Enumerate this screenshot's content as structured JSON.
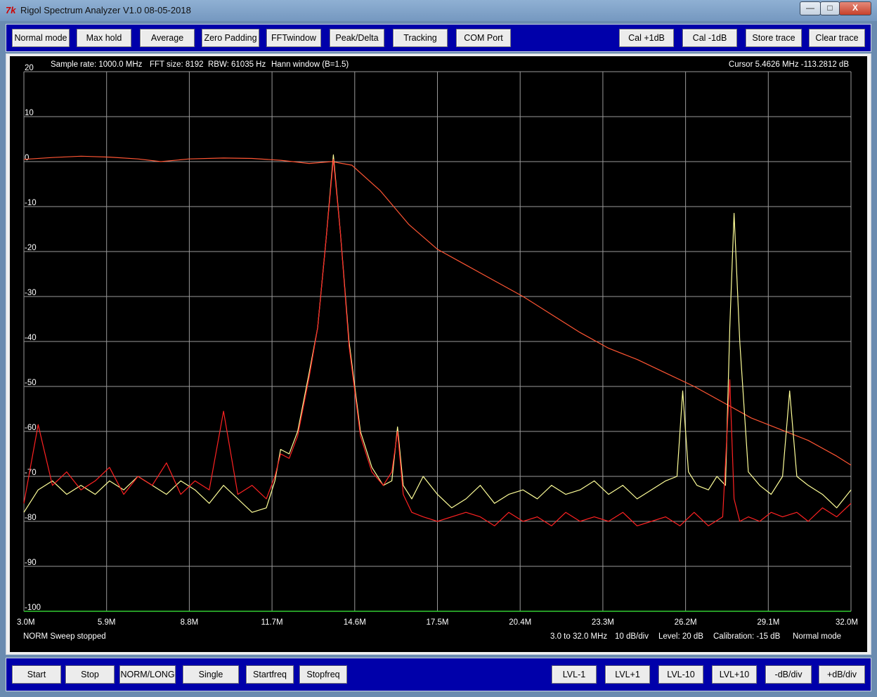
{
  "window": {
    "title": "Rigol Spectrum Analyzer V1.0 08-05-2018",
    "icon": "tk-feather-icon",
    "controls": [
      "—",
      "□",
      "X"
    ]
  },
  "toolbar_top": {
    "left": [
      "Normal mode",
      "Max hold",
      "Average",
      "Zero Padding",
      "FFTwindow",
      "Peak/Delta",
      "Tracking",
      "COM Port"
    ],
    "right": [
      "Cal +1dB",
      "Cal -1dB",
      "Store trace",
      "Clear trace"
    ]
  },
  "info": {
    "sample_rate": "Sample rate: 1000.0 MHz",
    "fft_size": "FFT size: 8192",
    "rbw": "RBW: 61035 Hz",
    "window": "Hann window (B=1.5)",
    "cursor": "Cursor 5.4626 MHz   -113.2812 dB"
  },
  "status": {
    "left": "NORM Sweep stopped",
    "span": "3.0 to 32.0 MHz",
    "scale": "10 dB/div",
    "level": "Level: 20 dB",
    "calibration": "Calibration: -15 dB",
    "mode": "Normal mode"
  },
  "toolbar_bottom": {
    "left": [
      "Start",
      "Stop",
      "NORM/LONG",
      "Single",
      "Startfreq",
      "Stopfreq"
    ],
    "right": [
      "LVL-1",
      "LVL+1",
      "LVL-10",
      "LVL+10",
      "-dB/div",
      "+dB/div"
    ]
  },
  "chart_data": {
    "type": "line",
    "xlabel": "",
    "ylabel": "",
    "xlim": [
      3.0,
      32.0
    ],
    "ylim": [
      -100,
      20
    ],
    "x_ticks": [
      "3.0M",
      "5.9M",
      "8.8M",
      "11.7M",
      "14.6M",
      "17.5M",
      "20.4M",
      "23.3M",
      "26.2M",
      "29.1M",
      "32.0M"
    ],
    "y_ticks": [
      "20",
      "10",
      "0",
      "-10",
      "-20",
      "-30",
      "-40",
      "-50",
      "-60",
      "-70",
      "-80",
      "-90",
      "-100"
    ],
    "grid": true,
    "colors": {
      "background": "#000000",
      "grid": "#9a9a9a",
      "baseline": "#33cc33",
      "filter": "#ff5533",
      "live": "#ffff99",
      "stored": "#ff2222"
    },
    "series": [
      {
        "color": "#ff5533",
        "x": [
          3.0,
          4.0,
          5.0,
          6.0,
          7.0,
          7.8,
          8.8,
          10.0,
          11.0,
          12.0,
          13.0,
          13.8,
          14.5,
          15.5,
          16.5,
          17.5,
          18.5,
          19.5,
          20.5,
          21.5,
          22.5,
          23.5,
          24.5,
          25.5,
          26.5,
          27.5,
          28.5,
          29.5,
          30.5,
          31.5,
          32.0
        ],
        "y": [
          0.5,
          0.9,
          1.2,
          1.0,
          0.6,
          0.0,
          0.6,
          0.8,
          0.7,
          0.3,
          -0.4,
          0.0,
          -0.8,
          -6.5,
          -14,
          -19.5,
          -23,
          -26.5,
          -30,
          -34,
          -38,
          -41.5,
          -44,
          -47,
          -50,
          -53.5,
          -57,
          -59.5,
          -62,
          -65.5,
          -67.5
        ]
      },
      {
        "color": "#ffff99",
        "x": [
          3.0,
          3.5,
          4.0,
          4.5,
          5.0,
          5.5,
          6.0,
          6.5,
          7.0,
          7.5,
          8.0,
          8.5,
          9.0,
          9.5,
          10.0,
          10.5,
          11.0,
          11.5,
          11.8,
          12.0,
          12.3,
          12.6,
          13.0,
          13.3,
          13.6,
          13.85,
          14.1,
          14.4,
          14.8,
          15.2,
          15.6,
          15.9,
          16.1,
          16.3,
          16.6,
          17.0,
          17.5,
          18.0,
          18.5,
          19.0,
          19.5,
          20.0,
          20.5,
          21.0,
          21.5,
          22.0,
          22.5,
          23.0,
          23.5,
          24.0,
          24.5,
          25.0,
          25.5,
          25.9,
          26.1,
          26.3,
          26.6,
          27.0,
          27.3,
          27.6,
          27.75,
          27.9,
          28.1,
          28.4,
          28.8,
          29.2,
          29.6,
          29.85,
          30.1,
          30.5,
          31.0,
          31.5,
          32.0
        ],
        "y": [
          -78,
          -73,
          -71,
          -74,
          -72,
          -74,
          -71,
          -73,
          -70,
          -72,
          -74,
          -71,
          -73,
          -76,
          -72,
          -75,
          -78,
          -77,
          -71,
          -64,
          -65,
          -60,
          -47,
          -37,
          -17,
          1.5,
          -16,
          -40,
          -60,
          -68,
          -72,
          -71,
          -59,
          -72,
          -75,
          -70,
          -74,
          -77,
          -75,
          -72,
          -76,
          -74,
          -73,
          -75,
          -72,
          -74,
          -73,
          -71,
          -74,
          -72,
          -75,
          -73,
          -71,
          -70,
          -51,
          -69,
          -72,
          -73,
          -70,
          -72,
          -37,
          -11.5,
          -40,
          -69,
          -72,
          -74,
          -70,
          -51,
          -70,
          -72,
          -74,
          -77,
          -73
        ]
      },
      {
        "color": "#ff2222",
        "x": [
          3.0,
          3.5,
          4.0,
          4.5,
          5.0,
          5.5,
          6.0,
          6.5,
          7.0,
          7.5,
          8.0,
          8.5,
          9.0,
          9.5,
          10.0,
          10.5,
          11.0,
          11.5,
          11.8,
          12.0,
          12.3,
          12.6,
          13.0,
          13.3,
          13.6,
          13.85,
          14.1,
          14.4,
          14.8,
          15.2,
          15.6,
          15.9,
          16.1,
          16.3,
          16.6,
          17.0,
          17.5,
          18.0,
          18.5,
          19.0,
          19.5,
          20.0,
          20.5,
          21.0,
          21.5,
          22.0,
          22.5,
          23.0,
          23.5,
          24.0,
          24.5,
          25.0,
          25.5,
          26.0,
          26.5,
          27.0,
          27.5,
          27.75,
          27.9,
          28.1,
          28.4,
          28.8,
          29.2,
          29.6,
          30.1,
          30.5,
          31.0,
          31.5,
          32.0
        ],
        "y": [
          -76,
          -58.5,
          -72,
          -69,
          -73,
          -71,
          -68,
          -74,
          -70,
          -72,
          -67,
          -74,
          -71,
          -73,
          -55.5,
          -74,
          -72,
          -75,
          -70,
          -65,
          -66,
          -61,
          -48,
          -37,
          -17,
          0.5,
          -16,
          -41,
          -61,
          -69,
          -72,
          -69,
          -60,
          -74,
          -78,
          -79,
          -80,
          -79,
          -78,
          -79,
          -81,
          -78,
          -80,
          -79,
          -81,
          -78,
          -80,
          -79,
          -80,
          -78,
          -81,
          -80,
          -79,
          -81,
          -78,
          -81,
          -79,
          -48.5,
          -75,
          -80,
          -79,
          -80,
          -78,
          -79,
          -78,
          -80,
          -77,
          -79,
          -76
        ]
      }
    ]
  }
}
